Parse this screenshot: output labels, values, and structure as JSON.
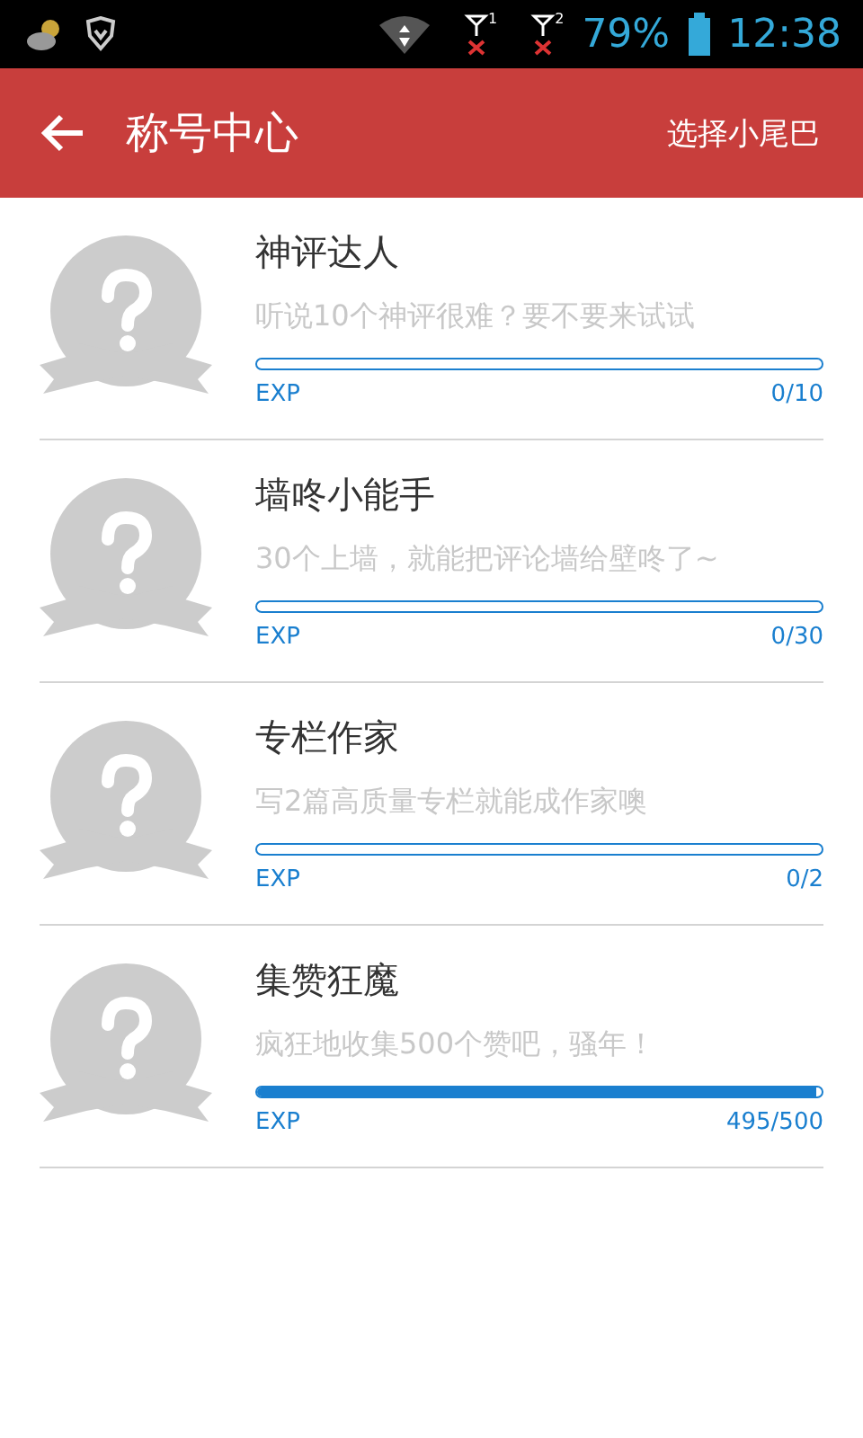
{
  "status_bar": {
    "sim_slots": [
      "1",
      "2"
    ],
    "battery": "79%",
    "time": "12:38"
  },
  "app_bar": {
    "title": "称号中心",
    "action": "选择小尾巴"
  },
  "titles": [
    {
      "name": "神评达人",
      "description": "听说10个神评很难？要不要来试试",
      "exp_label": "EXP",
      "progress": "0/10",
      "level": 0
    },
    {
      "name": "墙咚小能手",
      "description": "30个上墙，就能把评论墙给壁咚了~",
      "exp_label": "EXP",
      "progress": "0/30",
      "level": 0
    },
    {
      "name": "专栏作家",
      "description": "写2篇高质量专栏就能成作家噢",
      "exp_label": "EXP",
      "progress": "0/2",
      "level": 0
    },
    {
      "name": "集赞狂魔",
      "description": "疯狂地收集500个赞吧，骚年！",
      "exp_label": "EXP",
      "progress": "495/500",
      "level": 0.99
    }
  ]
}
